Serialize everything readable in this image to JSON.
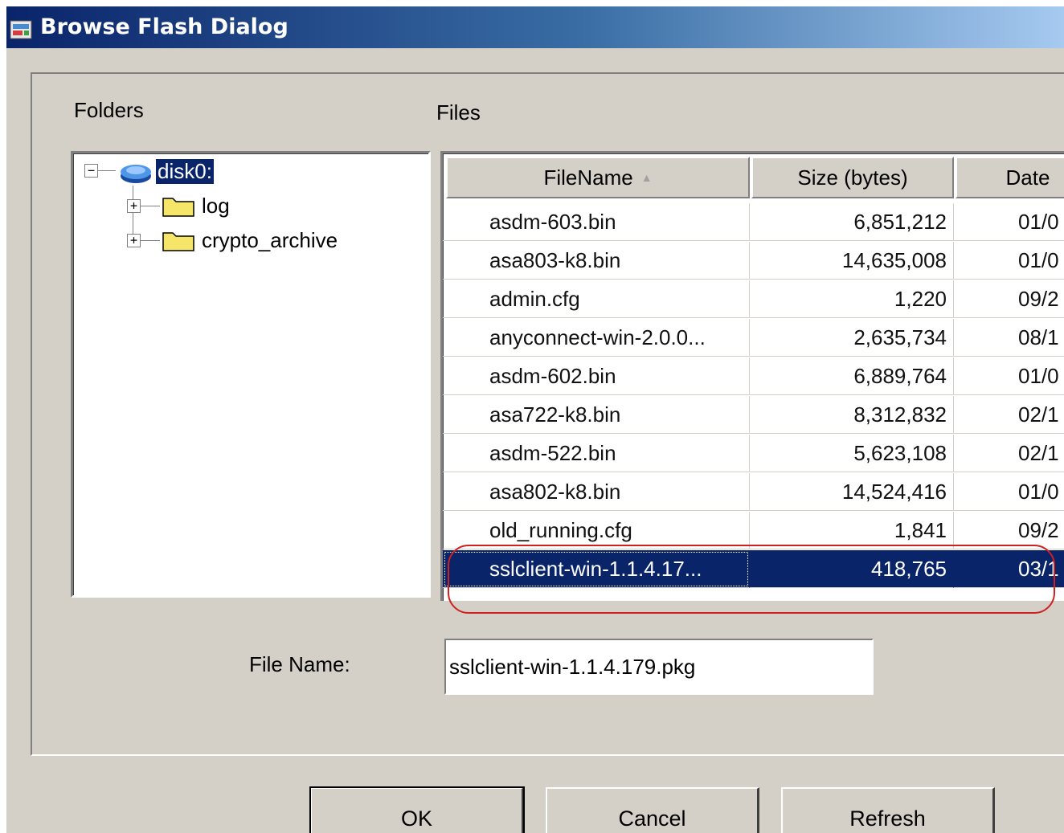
{
  "window": {
    "title": "Browse Flash Dialog"
  },
  "folders": {
    "label": "Folders",
    "root": "disk0:",
    "children": [
      "log",
      "crypto_archive"
    ]
  },
  "files": {
    "label": "Files",
    "columns": {
      "filename": "FileName",
      "size": "Size (bytes)",
      "date": "Date"
    },
    "rows": [
      {
        "name": "asdm-603.bin",
        "size": "6,851,212",
        "date": "01/0"
      },
      {
        "name": "asa803-k8.bin",
        "size": "14,635,008",
        "date": "01/0"
      },
      {
        "name": "admin.cfg",
        "size": "1,220",
        "date": "09/2"
      },
      {
        "name": "anyconnect-win-2.0.0...",
        "size": "2,635,734",
        "date": "08/1"
      },
      {
        "name": "asdm-602.bin",
        "size": "6,889,764",
        "date": "01/0"
      },
      {
        "name": "asa722-k8.bin",
        "size": "8,312,832",
        "date": "02/1"
      },
      {
        "name": "asdm-522.bin",
        "size": "5,623,108",
        "date": "02/1"
      },
      {
        "name": "asa802-k8.bin",
        "size": "14,524,416",
        "date": "01/0"
      },
      {
        "name": "old_running.cfg",
        "size": "1,841",
        "date": "09/2"
      },
      {
        "name": "sslclient-win-1.1.4.17...",
        "size": "418,765",
        "date": "03/1"
      }
    ],
    "selected_index": 9
  },
  "file_name": {
    "label": "File Name:",
    "value": "sslclient-win-1.1.4.179.pkg"
  },
  "buttons": {
    "ok": "OK",
    "cancel": "Cancel",
    "refresh": "Refresh"
  },
  "colors": {
    "selection": "#0a246a",
    "dialog_bg": "#d4d0c8",
    "annotation_ring": "#d02020"
  }
}
